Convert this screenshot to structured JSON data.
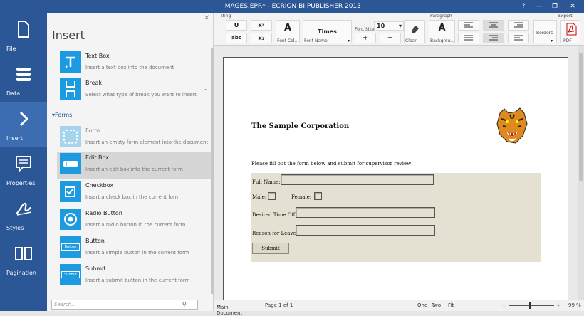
{
  "window": {
    "title": "IMAGES.EPR* - ECRION BI PUBLISHER 2013",
    "help": "?",
    "minimize": "—",
    "restore": "❐",
    "close": "✕"
  },
  "nav": [
    {
      "label": "File",
      "icon": "file-icon"
    },
    {
      "label": "Data",
      "icon": "database-icon"
    },
    {
      "label": "Insert",
      "icon": "chevron-right-icon",
      "active": true
    },
    {
      "label": "Properties",
      "icon": "properties-icon"
    },
    {
      "label": "Styles",
      "icon": "styles-icon"
    },
    {
      "label": "Pagination",
      "icon": "pagination-icon"
    }
  ],
  "panel": {
    "title": "Insert",
    "close": "✕",
    "section_forms": "Forms",
    "search_placeholder": "Search...",
    "items": [
      {
        "title": "Text Box",
        "desc": "Insert a text box into the document"
      },
      {
        "title": "Break",
        "desc": "Select what type of break you want to insert"
      },
      {
        "title": "Form",
        "desc": "Insert an empty form element into the document"
      },
      {
        "title": "Edit Box",
        "desc": "Insert an edit box into the current form"
      },
      {
        "title": "Checkbox",
        "desc": "Insert a check box in the current form"
      },
      {
        "title": "Radio Button",
        "desc": "Insert a radio button in the current form"
      },
      {
        "title": "Button",
        "desc": "Insert a simple button in the current form"
      },
      {
        "title": "Submit",
        "desc": "Insert a submit button in the current form"
      }
    ],
    "button_tile_text": "Button",
    "submit_tile_text": "Submit"
  },
  "ribbon": {
    "group_editing": "Editing",
    "group_paragraph": "Paragraph",
    "group_export": "Export",
    "underline": "U",
    "superscript": "x²",
    "strikethrough": "abc",
    "subscript": "x₂",
    "font_color_label": "Font Col...",
    "font_color_letter": "A",
    "font_name": "Times",
    "font_name_label": "Font Name",
    "font_size_label": "Font Size",
    "font_size": "10",
    "increase": "+",
    "decrease": "−",
    "clear_label": "Clear",
    "background_label": "Backgrou...",
    "background_letter": "A",
    "borders_label": "Borders",
    "pdf_label": "PDF"
  },
  "document": {
    "title": "The Sample Corporation",
    "instructions": "Please fill out the form below and submit for supervisor review:",
    "full_name_label": "Full Name:",
    "male_label": "Male:",
    "female_label": "Female:",
    "time_off_label": "Desired Time Off:",
    "reason_label": "Reason for Leave:",
    "submit_label": "Submit"
  },
  "status": {
    "document": "Main Document",
    "page": "Page 1 of 1",
    "one": "One",
    "two": "Two",
    "fit": "Fit",
    "zoom_minus": "−",
    "zoom_plus": "+",
    "zoom": "99 %"
  },
  "colors": {
    "accent": "#2b5797",
    "tile": "#1c9be0",
    "form_bg": "#e4e0d2"
  }
}
